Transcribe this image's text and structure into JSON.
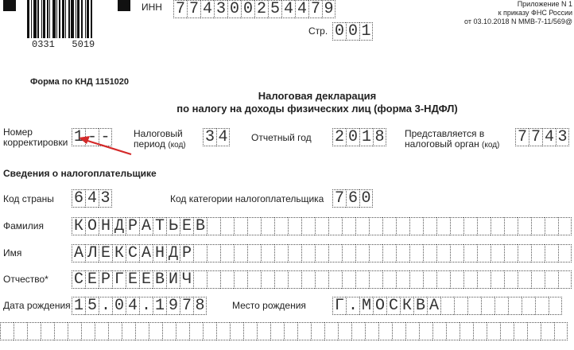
{
  "header": {
    "inn_label": "ИНН",
    "inn_value": "774300254479",
    "page_label": "Стр.",
    "page_value": "001",
    "barcode_left": "0331",
    "barcode_right": "5019",
    "appendix_line1": "Приложение N 1",
    "appendix_line2": "к приказу ФНС России",
    "appendix_line3": "от 03.10.2018 N ММВ-7-11/569@"
  },
  "form": {
    "knd_label": "Форма по КНД 1151020",
    "title_line1": "Налоговая декларация",
    "title_line2": "по налогу на доходы физических лиц (форма 3-НДФЛ)"
  },
  "fields": {
    "correction_label_1": "Номер",
    "correction_label_2": "корректировки",
    "correction_value": "1--",
    "tax_period_label_1": "Налоговый",
    "tax_period_label_2": "период",
    "tax_period_code": "(код)",
    "tax_period_value": "34",
    "report_year_label": "Отчетный год",
    "report_year_value": "2018",
    "tax_authority_label_1": "Представляется в",
    "tax_authority_label_2": "налоговый орган",
    "tax_authority_code": "(код)",
    "tax_authority_value": "7743"
  },
  "taxpayer": {
    "section_title": "Сведения о налогоплательщике",
    "country_label": "Код страны",
    "country_value": "643",
    "category_label": "Код категории налогоплательщика",
    "category_value": "760",
    "surname_label": "Фамилия",
    "surname_value": "КОНДРАТЬЕВ",
    "name_label": "Имя",
    "name_value": "АЛЕКСАНДР",
    "patronymic_label": "Отчество*",
    "patronymic_value": "СЕРГЕЕВИЧ",
    "birthdate_label": "Дата рождения",
    "birthdate_value": "15.04.1978",
    "birthplace_label": "Место рождения",
    "birthplace_value": "Г.МОСКВА"
  },
  "colors": {
    "arrow": "#d42a2a",
    "text": "#222222",
    "cell_border": "#555555"
  }
}
